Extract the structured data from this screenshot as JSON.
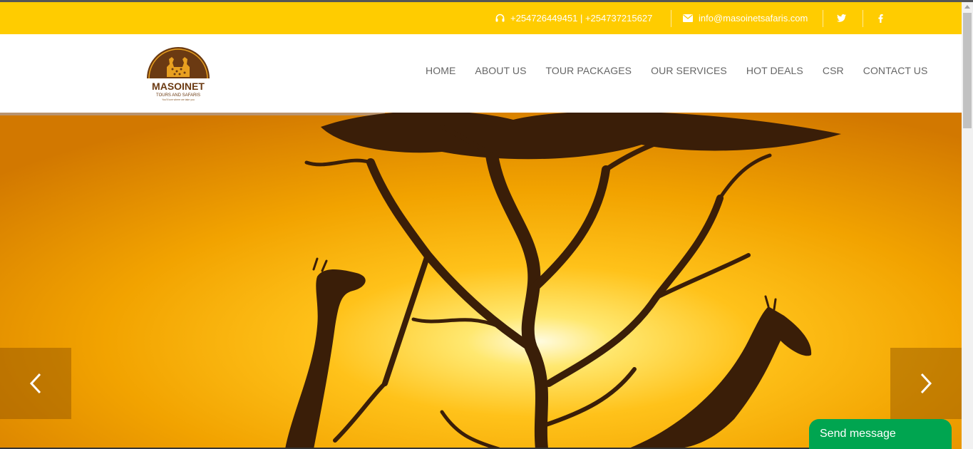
{
  "colors": {
    "topbar_bg": "#ffcc00",
    "nav_text": "#666666",
    "logo_brown": "#6b3a12",
    "send_message_bg": "#00a550"
  },
  "topbar": {
    "phone_icon": "headset-icon",
    "phones": "+254726449451 | +254737215627",
    "email_icon": "envelope-icon",
    "email": "info@masoinetsafaris.com",
    "social": [
      "twitter-icon",
      "facebook-icon"
    ]
  },
  "logo": {
    "name": "MASOINET",
    "tagline": "TOURS AND SAFARIS",
    "slogan": "You'll love where we take you"
  },
  "nav": {
    "items": [
      "HOME",
      "ABOUT US",
      "TOUR PACKAGES",
      "OUR SERVICES",
      "HOT DEALS",
      "CSR",
      "CONTACT US"
    ]
  },
  "hero": {
    "image": "sunset-giraffes-acacia-tree",
    "prev_icon": "chevron-left-icon",
    "next_icon": "chevron-right-icon"
  },
  "chat": {
    "label": "Send message"
  }
}
